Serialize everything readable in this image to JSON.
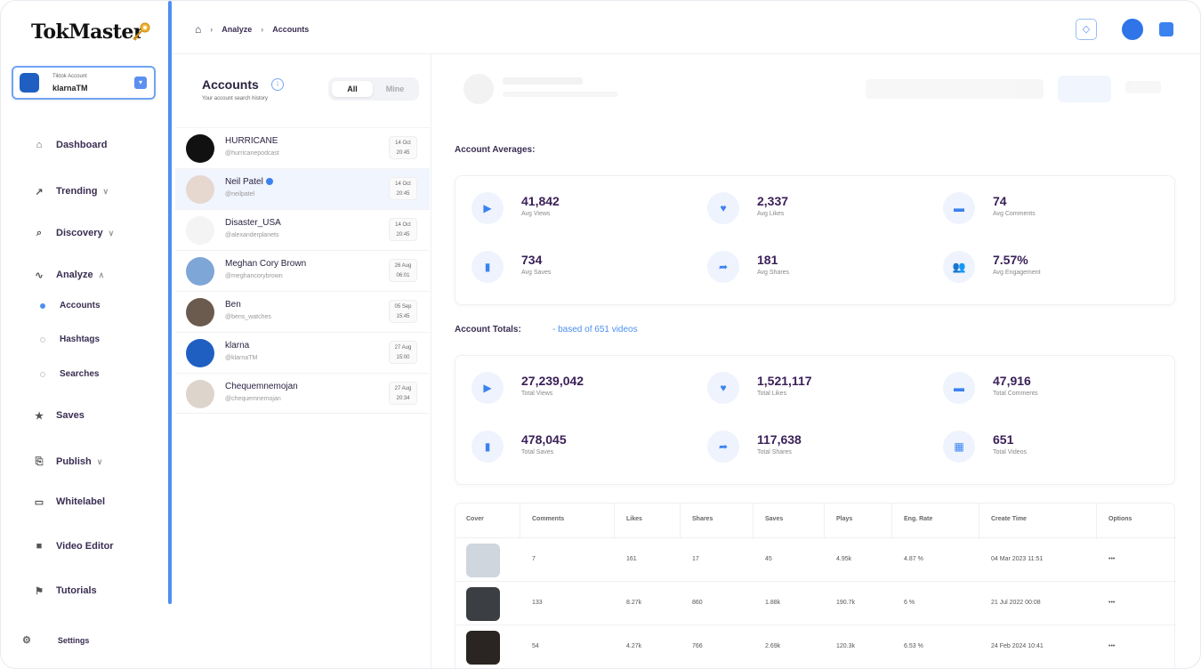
{
  "brand": {
    "logo_text": "TokMaster"
  },
  "account_switcher": {
    "label": "Tiktok Account",
    "name": "klarnaTM"
  },
  "sidebar": {
    "items": [
      {
        "label": "Dashboard"
      },
      {
        "label": "Trending"
      },
      {
        "label": "Discovery"
      },
      {
        "label": "Analyze"
      },
      {
        "label": "Saves"
      },
      {
        "label": "Publish"
      },
      {
        "label": "Whitelabel"
      },
      {
        "label": "Video Editor"
      },
      {
        "label": "Tutorials"
      }
    ],
    "analyze_sub": [
      {
        "label": "Accounts"
      },
      {
        "label": "Hashtags"
      },
      {
        "label": "Searches"
      }
    ],
    "settings": "Settings"
  },
  "breadcrumb": {
    "first": "Analyze",
    "second": "Accounts"
  },
  "accounts_panel": {
    "title": "Accounts",
    "subtitle": "Your account search history",
    "filter": {
      "all": "All",
      "other": "Mine"
    },
    "rows": [
      {
        "name": "HURRICANE",
        "handle": "@hurricanepodcast",
        "date1": "14 Oct",
        "date2": "20:45"
      },
      {
        "name": "Neil Patel",
        "handle": "@neilpatel",
        "date1": "14 Oct",
        "date2": "20:45"
      },
      {
        "name": "Disaster_USA",
        "handle": "@alexanderplanets",
        "date1": "14 Oct",
        "date2": "20:45"
      },
      {
        "name": "Meghan Cory Brown",
        "handle": "@meghancorybrown",
        "date1": "26 Aug",
        "date2": "06:01"
      },
      {
        "name": "Ben",
        "handle": "@bens_watches",
        "date1": "05 Sep",
        "date2": "15:45"
      },
      {
        "name": "klarna",
        "handle": "@klarnaTM",
        "date1": "27 Aug",
        "date2": "15:00"
      },
      {
        "name": "Chequemnemojan",
        "handle": "@chequemnemojan",
        "date1": "27 Aug",
        "date2": "20:34"
      }
    ]
  },
  "averages": {
    "title": "Account Averages:",
    "stats": [
      {
        "value": "41,842",
        "label": "Avg Views"
      },
      {
        "value": "2,337",
        "label": "Avg Likes"
      },
      {
        "value": "74",
        "label": "Avg Comments"
      },
      {
        "value": "734",
        "label": "Avg Saves"
      },
      {
        "value": "181",
        "label": "Avg Shares"
      },
      {
        "value": "7.57%",
        "label": "Avg Engagement"
      }
    ]
  },
  "totals": {
    "title": "Account Totals:",
    "note": "- based of 651 videos",
    "stats": [
      {
        "value": "27,239,042",
        "label": "Total Views"
      },
      {
        "value": "1,521,117",
        "label": "Total Likes"
      },
      {
        "value": "47,916",
        "label": "Total Comments"
      },
      {
        "value": "478,045",
        "label": "Total Saves"
      },
      {
        "value": "117,638",
        "label": "Total Shares"
      },
      {
        "value": "651",
        "label": "Total Videos"
      }
    ]
  },
  "table": {
    "headers": [
      "Cover",
      "Comments",
      "Likes",
      "Shares",
      "Saves",
      "Plays",
      "Eng. Rate",
      "Create Time",
      "Options"
    ],
    "rows": [
      {
        "comments": "7",
        "likes": "161",
        "shares": "17",
        "saves": "45",
        "plays": "4.95k",
        "eng": "4.87 %",
        "time": "04 Mar 2023 11:51",
        "options": "•••"
      },
      {
        "comments": "133",
        "likes": "8.27k",
        "shares": "860",
        "saves": "1.88k",
        "plays": "190.7k",
        "eng": "6 %",
        "time": "21 Jul 2022 00:08",
        "options": "•••"
      },
      {
        "comments": "54",
        "likes": "4.27k",
        "shares": "766",
        "saves": "2.69k",
        "plays": "120.3k",
        "eng": "6.53 %",
        "time": "24 Feb 2024 10:41",
        "options": "•••"
      }
    ]
  },
  "colors": {
    "accent": "#3b82f0",
    "text_dark": "#3a1f57",
    "bubble": "#eef3fd"
  },
  "icons": [
    "home-icon",
    "bell-icon",
    "user-icon",
    "menu-icon",
    "video-icon",
    "heart-icon",
    "comment-icon",
    "bookmark-icon",
    "share-icon",
    "people-icon",
    "film-icon"
  ]
}
